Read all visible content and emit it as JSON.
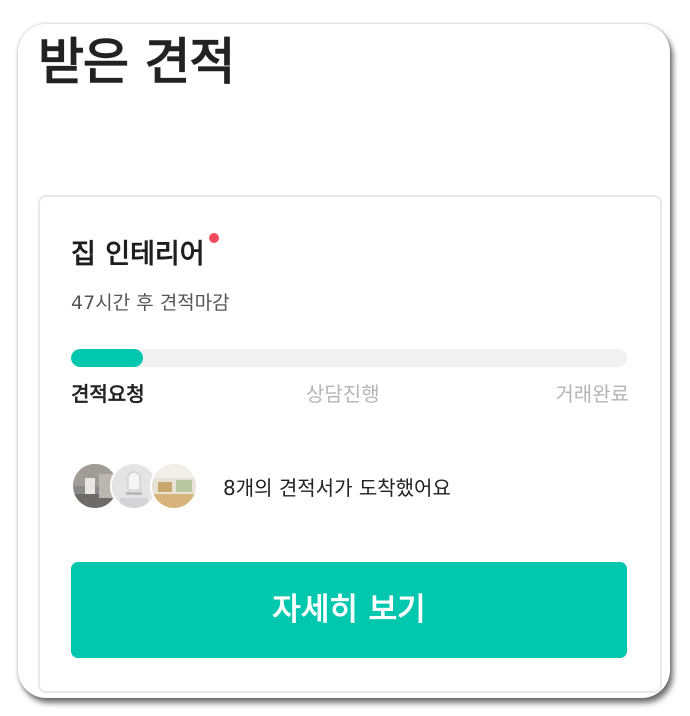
{
  "page": {
    "title": "받은 견적"
  },
  "card": {
    "title": "집 인테리어",
    "deadline": "47시간 후 견적마감",
    "progress": 0.13,
    "steps": [
      {
        "label": "견적요청",
        "active": true
      },
      {
        "label": "상담진행",
        "active": false
      },
      {
        "label": "거래완료",
        "active": false
      }
    ],
    "quotes_text": "8개의 견적서가 도착했어요",
    "cta_label": "자세히 보기"
  },
  "colors": {
    "accent": "#00c7ae",
    "new_dot": "#f1495b",
    "track": "#f1f1f1",
    "inactive_text": "#b5b5b5"
  }
}
